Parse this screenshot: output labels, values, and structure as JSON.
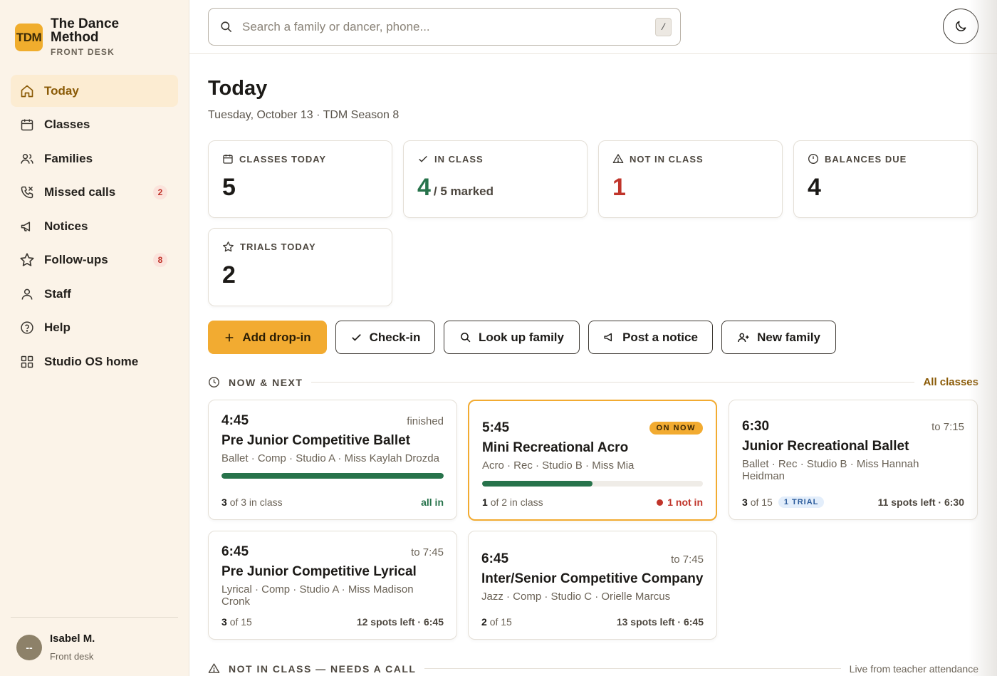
{
  "brand": {
    "logo": "TDM",
    "name": "The Dance Method",
    "sub": "FRONT DESK"
  },
  "nav": [
    {
      "label": "Today",
      "icon": "home-icon",
      "active": true
    },
    {
      "label": "Classes",
      "icon": "calendar-icon"
    },
    {
      "label": "Families",
      "icon": "users-icon"
    },
    {
      "label": "Missed calls",
      "icon": "phone-missed-icon",
      "badge": "2"
    },
    {
      "label": "Notices",
      "icon": "megaphone-icon"
    },
    {
      "label": "Follow-ups",
      "icon": "star-icon",
      "badge": "8"
    },
    {
      "label": "Staff",
      "icon": "user-icon"
    },
    {
      "label": "Help",
      "icon": "help-circle-icon"
    },
    {
      "label": "Studio OS home",
      "icon": "grid-icon"
    }
  ],
  "user": {
    "initials": "--",
    "name": "Isabel M.",
    "role": "Front desk"
  },
  "search": {
    "placeholder": "Search a family or dancer, phone...",
    "shortcut": "/"
  },
  "page": {
    "title": "Today",
    "subtitle": "Tuesday, October 13 · TDM Season 8"
  },
  "stats": [
    {
      "label": "CLASSES TODAY",
      "value": "5",
      "icon": "calendar-icon"
    },
    {
      "label": "IN CLASS",
      "value": "4",
      "suffix": "/ 5 marked",
      "icon": "check-icon",
      "color": "#27734b"
    },
    {
      "label": "NOT IN CLASS",
      "value": "1",
      "icon": "alert-triangle-icon",
      "color": "#c0342a"
    },
    {
      "label": "BALANCES DUE",
      "value": "4",
      "icon": "clock-icon"
    },
    {
      "label": "TRIALS TODAY",
      "value": "2",
      "icon": "star-icon"
    }
  ],
  "actions": [
    {
      "label": "Add drop-in",
      "icon": "plus-icon",
      "primary": true
    },
    {
      "label": "Check-in",
      "icon": "check-icon"
    },
    {
      "label": "Look up family",
      "icon": "search-icon"
    },
    {
      "label": "Post a notice",
      "icon": "megaphone-icon"
    },
    {
      "label": "New family",
      "icon": "user-plus-icon"
    }
  ],
  "now_next": {
    "title": "NOW & NEXT",
    "link": "All classes",
    "classes": [
      {
        "time": "4:45",
        "status": "finished",
        "name": "Pre Junior Competitive Ballet",
        "meta": "Ballet · Comp · Studio A · Miss Kaylah Drozda",
        "count": "3",
        "count_suffix": "of 3 in class",
        "progress": 1.0,
        "right": "all in"
      },
      {
        "time": "5:45",
        "status": "ON NOW",
        "name": "Mini Recreational Acro",
        "meta": "Acro · Rec · Studio B · Miss Mia",
        "count": "1",
        "count_suffix": "of 2 in class",
        "progress": 0.5,
        "right": "1 not in"
      },
      {
        "time": "6:30",
        "status": "to 7:15",
        "name": "Junior Recreational Ballet",
        "meta": "Ballet · Rec · Studio B · Miss Hannah Heidman",
        "count": "3",
        "count_suffix": "of 15",
        "badge": "1 TRIAL",
        "right": "11 spots left · 6:30"
      },
      {
        "time": "6:45",
        "status": "to 7:45",
        "name": "Pre Junior Competitive Lyrical",
        "meta": "Lyrical · Comp · Studio A · Miss Madison Cronk",
        "count": "3",
        "count_suffix": "of 15",
        "right": "12 spots left · 6:45"
      },
      {
        "time": "6:45",
        "status": "to 7:45",
        "name": "Inter/Senior Competitive Company",
        "meta": "Jazz · Comp · Studio C · Orielle Marcus",
        "count": "2",
        "count_suffix": "of 15",
        "right": "13 spots left · 6:45"
      }
    ]
  },
  "not_in_class": {
    "title": "NOT IN CLASS — NEEDS A CALL",
    "note": "Live from teacher attendance"
  }
}
